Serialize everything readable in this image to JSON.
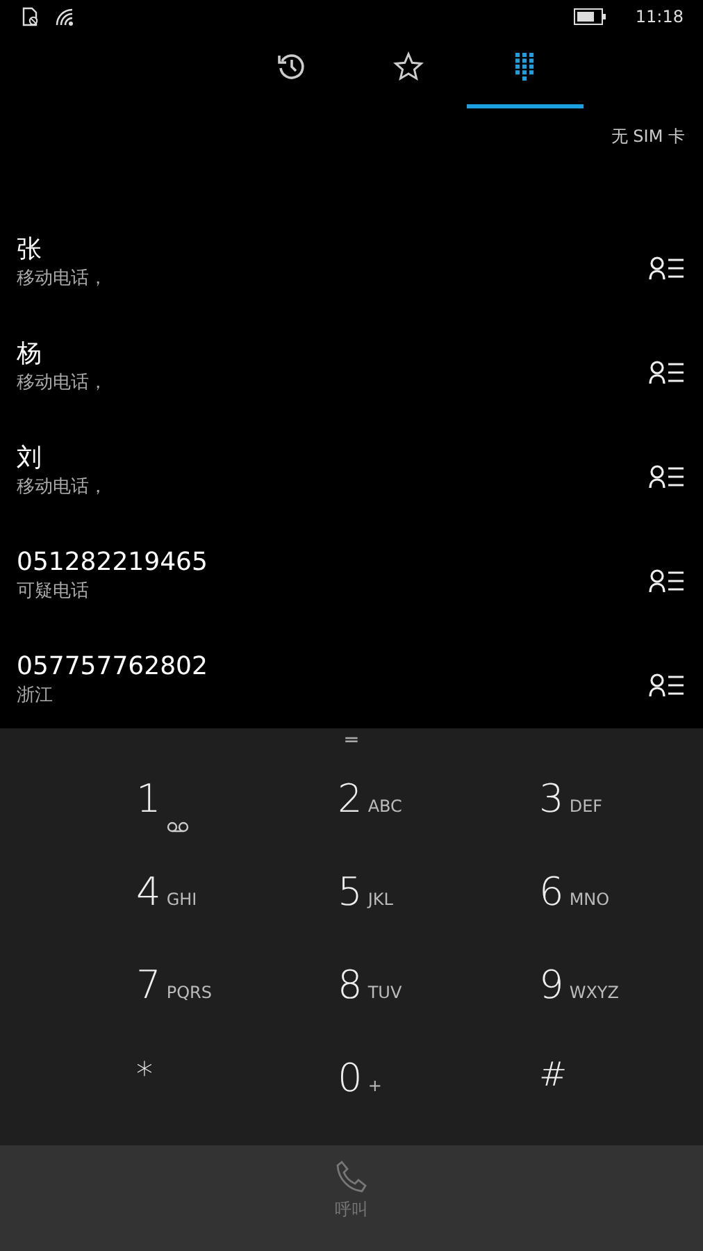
{
  "status_bar": {
    "time": "11:18"
  },
  "tabs": [
    {
      "kind": "history",
      "selected": false
    },
    {
      "kind": "favorites",
      "selected": false
    },
    {
      "kind": "dialpad",
      "selected": true
    }
  ],
  "sim_status": "无 SIM 卡",
  "calls": [
    {
      "name": "张",
      "detail": "移动电话，"
    },
    {
      "name": "杨",
      "detail": "移动电话，"
    },
    {
      "name": "刘",
      "detail": "移动电话，"
    },
    {
      "name": "051282219465",
      "detail": "可疑电话"
    },
    {
      "name": "057757762802",
      "detail": "浙江"
    }
  ],
  "keypad": {
    "handle": "═",
    "keys": [
      {
        "digit": "1",
        "kind": "voicemail"
      },
      {
        "digit": "2",
        "kind": "letters",
        "letters": "ABC"
      },
      {
        "digit": "3",
        "kind": "letters",
        "letters": "DEF"
      },
      {
        "digit": "4",
        "kind": "letters",
        "letters": "GHI"
      },
      {
        "digit": "5",
        "kind": "letters",
        "letters": "JKL"
      },
      {
        "digit": "6",
        "kind": "letters",
        "letters": "MNO"
      },
      {
        "digit": "7",
        "kind": "letters",
        "letters": "PQRS"
      },
      {
        "digit": "8",
        "kind": "letters",
        "letters": "TUV"
      },
      {
        "digit": "9",
        "kind": "letters",
        "letters": "WXYZ"
      },
      {
        "digit": "*",
        "kind": "plain"
      },
      {
        "digit": "0",
        "kind": "letters",
        "letters": "+"
      },
      {
        "digit": "#",
        "kind": "plain"
      }
    ]
  },
  "call_button": {
    "label": "呼叫",
    "disabled": true
  }
}
